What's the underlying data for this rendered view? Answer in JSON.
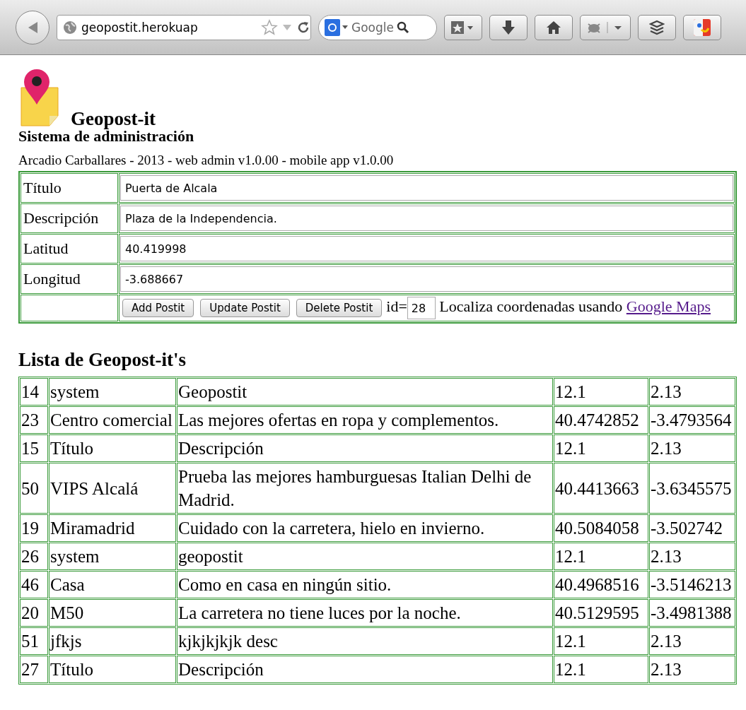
{
  "browser": {
    "url": "geopostit.herokuap",
    "search_placeholder": "Google"
  },
  "header": {
    "title": "Geopost-it",
    "subtitle": "Sistema de administración",
    "credits": "Arcadio Carballares - 2013 - web admin v1.0.00 - mobile app v1.0.00"
  },
  "form": {
    "fields": [
      {
        "label": "Título",
        "value": "Puerta de Alcala"
      },
      {
        "label": "Descripción",
        "value": "Plaza de la Independencia."
      },
      {
        "label": "Latitud",
        "value": "40.419998"
      },
      {
        "label": "Longitud",
        "value": "-3.688667"
      }
    ],
    "buttons": [
      "Add Postit",
      "Update Postit",
      "Delete Postit"
    ],
    "id_label": "id=",
    "id_value": "28",
    "locate_text": "Localiza coordenadas usando",
    "locate_link": "Google Maps"
  },
  "list": {
    "title": "Lista de Geopost-it's",
    "rows": [
      [
        "14",
        "system",
        "Geopostit",
        "12.1",
        "2.13"
      ],
      [
        "23",
        "Centro comercial",
        "Las mejores ofertas en ropa y complementos.",
        "40.4742852",
        "-3.4793564"
      ],
      [
        "15",
        "Título",
        "Descripción",
        "12.1",
        "2.13"
      ],
      [
        "50",
        "VIPS Alcalá",
        "Prueba las mejores hamburguesas Italian Delhi de Madrid.",
        "40.4413663",
        "-3.6345575"
      ],
      [
        "19",
        "Miramadrid",
        "Cuidado con la carretera, hielo en invierno.",
        "40.5084058",
        "-3.502742"
      ],
      [
        "26",
        "system",
        "geopostit",
        "12.1",
        "2.13"
      ],
      [
        "46",
        "Casa",
        "Como en casa en ningún sitio.",
        "40.4968516",
        "-3.5146213"
      ],
      [
        "20",
        "M50",
        "La carretera no tiene luces por la noche.",
        "40.5129595",
        "-3.4981388"
      ],
      [
        "51",
        "jfkjs",
        "kjkjkjkjk desc",
        "12.1",
        "2.13"
      ],
      [
        "27",
        "Título",
        "Descripción",
        "12.1",
        "2.13"
      ]
    ]
  }
}
